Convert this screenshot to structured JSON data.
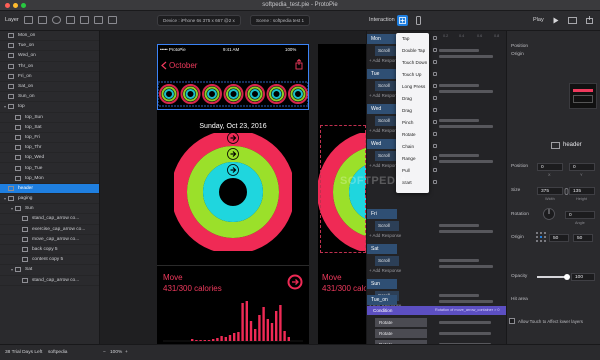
{
  "window": {
    "title": "softpedia_test.pie - ProtoPie",
    "colors": {
      "close": "#ff5f57",
      "minimize": "#febc2e",
      "zoom": "#28c840"
    }
  },
  "toolbar": {
    "layer_label": "Layer",
    "device_text": "Device : iPhone 6s  375 x 667 @2 x",
    "scene_text": "Scene : softpedia test 1",
    "interaction_label": "Interaction",
    "play_label": "Play"
  },
  "layers": [
    {
      "name": "Mon_on",
      "indent": 0,
      "caret": "",
      "selected": false
    },
    {
      "name": "Tue_on",
      "indent": 0,
      "caret": "",
      "selected": false
    },
    {
      "name": "Wed_on",
      "indent": 0,
      "caret": "",
      "selected": false
    },
    {
      "name": "Thr_on",
      "indent": 0,
      "caret": "",
      "selected": false
    },
    {
      "name": "Fri_on",
      "indent": 0,
      "caret": "",
      "selected": false
    },
    {
      "name": "Sat_on",
      "indent": 0,
      "caret": "",
      "selected": false
    },
    {
      "name": "Sun_on",
      "indent": 0,
      "caret": "",
      "selected": false
    },
    {
      "name": "top",
      "indent": 0,
      "caret": "▾",
      "selected": false
    },
    {
      "name": "top_Sun",
      "indent": 1,
      "caret": "",
      "selected": false
    },
    {
      "name": "top_Sat",
      "indent": 1,
      "caret": "",
      "selected": false
    },
    {
      "name": "top_Fri",
      "indent": 1,
      "caret": "",
      "selected": false
    },
    {
      "name": "top_Thr",
      "indent": 1,
      "caret": "",
      "selected": false
    },
    {
      "name": "top_Wed",
      "indent": 1,
      "caret": "",
      "selected": false
    },
    {
      "name": "top_Tue",
      "indent": 1,
      "caret": "",
      "selected": false
    },
    {
      "name": "top_Mon",
      "indent": 1,
      "caret": "",
      "selected": false
    },
    {
      "name": "header",
      "indent": 0,
      "caret": "",
      "selected": true
    },
    {
      "name": "paging",
      "indent": 0,
      "caret": "▾",
      "selected": false
    },
    {
      "name": "Sun",
      "indent": 1,
      "caret": "▾",
      "selected": false
    },
    {
      "name": "stand_cap_arrow co...",
      "indent": 2,
      "caret": "",
      "selected": false
    },
    {
      "name": "exercise_cap_arrow co...",
      "indent": 2,
      "caret": "",
      "selected": false
    },
    {
      "name": "move_cap_arrow co...",
      "indent": 2,
      "caret": "",
      "selected": false
    },
    {
      "name": "back copy 5",
      "indent": 2,
      "caret": "",
      "selected": false
    },
    {
      "name": "content copy 5",
      "indent": 2,
      "caret": "",
      "selected": false
    },
    {
      "name": "Sat",
      "indent": 1,
      "caret": "▾",
      "selected": false
    },
    {
      "name": "stand_cap_arrow co...",
      "indent": 2,
      "caret": "",
      "selected": false
    }
  ],
  "phone": {
    "carrier": "••••• ProtoPie",
    "time": "9:41 AM",
    "battery": "100%",
    "title": "October",
    "date": "Sunday, Oct 23, 2016",
    "move_label": "Move",
    "move_value": "431/300 calories",
    "colors": {
      "move": "#ef2a55",
      "exercise": "#9be02a",
      "stand": "#1fd6de"
    }
  },
  "timeline": {
    "ruler": [
      "0.2",
      "0.4",
      "0.6",
      "0.8"
    ],
    "triggers": [
      "Tap",
      "Double Tap",
      "Touch Down",
      "Touch Up",
      "Long Press",
      "Drag",
      "Drag",
      "Pinch",
      "Rotate",
      "Chain",
      "Range",
      "Pull",
      "Start"
    ],
    "groups": [
      {
        "head": "Mon",
        "sub": "Scroll",
        "add": "+ Add Response"
      },
      {
        "head": "Tue",
        "sub": "Scroll",
        "add": "+ Add Response"
      },
      {
        "head": "Wed",
        "sub": "Scroll",
        "add": "+ Add Response"
      },
      {
        "head": "Wed",
        "sub": "Scroll",
        "add": "+ Add Response"
      },
      {
        "head": "Fri",
        "sub": "Scroll",
        "add": "+ Add Response"
      },
      {
        "head": "Sat",
        "sub": "Scroll",
        "add": "+ Add Response"
      },
      {
        "head": "Sun",
        "sub": "Scroll",
        "add": "+ Add Response"
      },
      {
        "head": "Tue_on",
        "sub": "",
        "add": ""
      }
    ],
    "condition_label": "Condition",
    "condition_note": "Rotation of move_arrow_container > 0",
    "rotate_rows": [
      "Rotate",
      "Rotate",
      "Rotate",
      "Rotate"
    ]
  },
  "props": {
    "position_label": "Position",
    "opacity_label": "Opacity",
    "origin_label": "Origin",
    "layer_name": "header",
    "position_x": "0",
    "position_y": "0",
    "size_label": "Size",
    "size_w": "375",
    "size_h": "135",
    "rotation_label": "Rotation",
    "rotation_value": "0",
    "origin_label2": "Origin",
    "origin_x": "50",
    "origin_y": "50",
    "opacity_label2": "Opacity",
    "opacity_value": "100",
    "hit_area_label": "Hit area",
    "allow_touch_label": "Allow Touch to Affect lower layers",
    "sub_x": "X",
    "sub_y": "Y",
    "sub_w": "Width",
    "sub_h": "Height",
    "sub_angle": "Angle",
    "opacity_level": 1.0
  },
  "status": {
    "trial": "38 Trial Days Left",
    "user": "softpedia",
    "zoom": "100%"
  },
  "watermark": "SOFTPEDIA"
}
